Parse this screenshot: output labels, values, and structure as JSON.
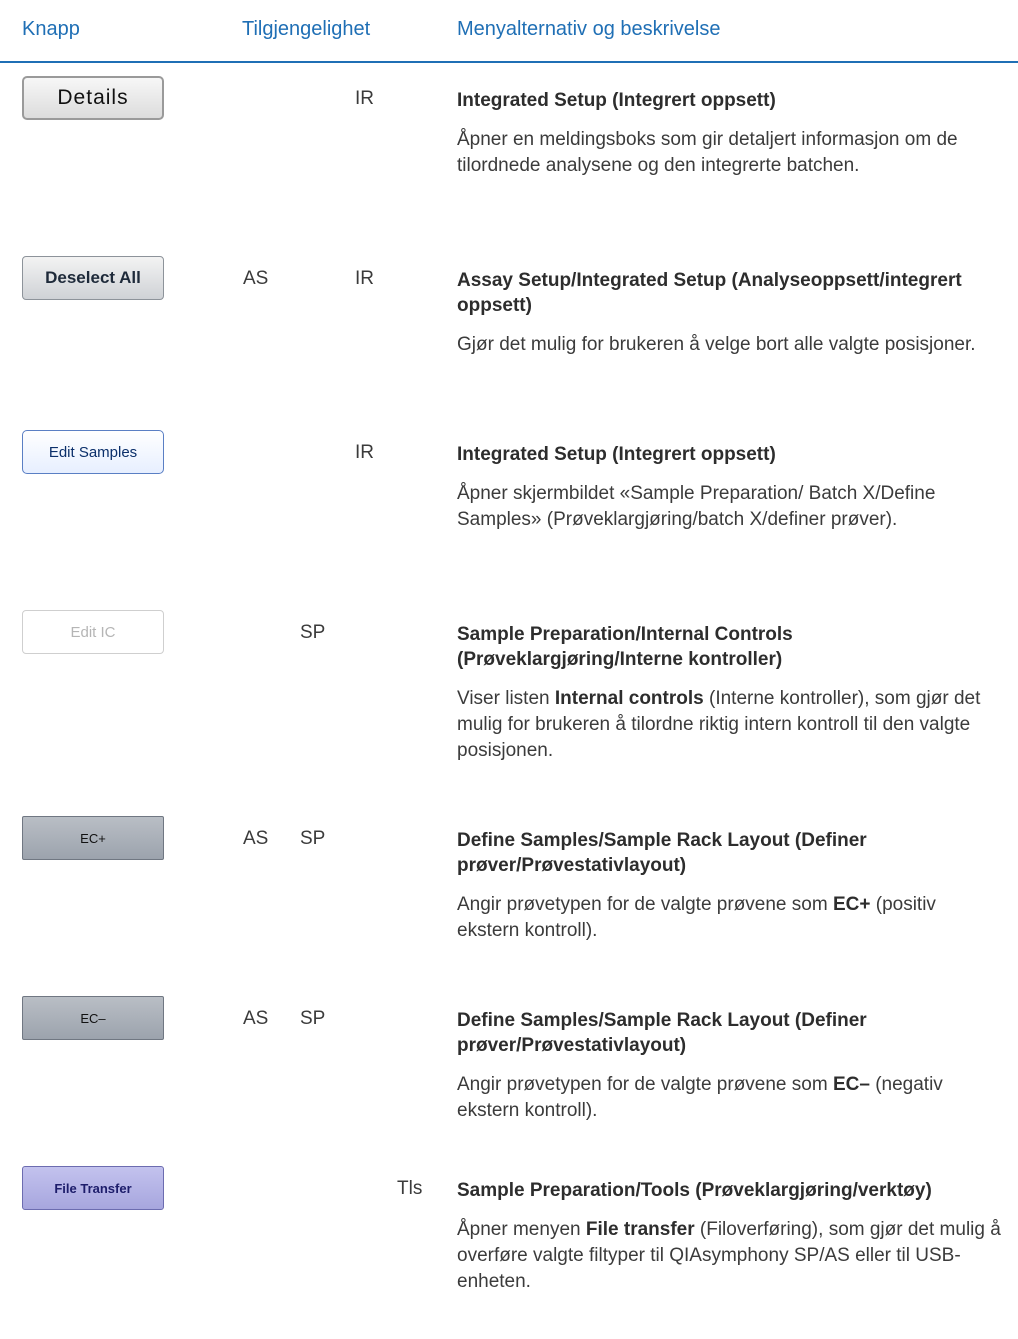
{
  "header": {
    "col1": "Knapp",
    "col2": "Tilgjengelighet",
    "col3": "Menyalternativ og beskrivelse"
  },
  "rows": [
    {
      "button_label": "Details",
      "avail_as": "",
      "avail_sp": "",
      "avail_ir": "IR",
      "avail_tls": "",
      "title": "Integrated Setup (Integrert oppsett)",
      "text": "Åpner en meldingsboks som gir detaljert informasjon om de tilordnede analysene og den integrerte batchen."
    },
    {
      "button_label": "Deselect All",
      "avail_as": "AS",
      "avail_sp": "",
      "avail_ir": "IR",
      "avail_tls": "",
      "title": "Assay Setup/Integrated Setup (Analyseoppsett/integrert oppsett)",
      "text": "Gjør det mulig for brukeren å velge bort alle valgte posisjoner."
    },
    {
      "button_label": "Edit Samples",
      "avail_as": "",
      "avail_sp": "",
      "avail_ir": "IR",
      "avail_tls": "",
      "title": "Integrated Setup (Integrert oppsett)",
      "text": "Åpner skjermbildet «Sample Preparation/ Batch X/Define Samples» (Prøveklargjøring/batch X/definer prøver)."
    },
    {
      "button_label": "Edit IC",
      "avail_as": "",
      "avail_sp": "SP",
      "avail_ir": "",
      "avail_tls": "",
      "title": "Sample Preparation/Internal Controls (Prøveklargjøring/Interne kontroller)",
      "text_pre": "Viser listen ",
      "text_bold": "Internal controls",
      "text_post": " (Interne kontroller), som gjør det mulig for brukeren å tilordne riktig intern kontroll til den valgte posisjonen."
    },
    {
      "button_label": "EC+",
      "avail_as": "AS",
      "avail_sp": "SP",
      "avail_ir": "",
      "avail_tls": "",
      "title": "Define Samples/Sample Rack Layout (Definer prøver/Prøvestativlayout)",
      "text_pre": "Angir prøvetypen for de valgte prøvene som ",
      "text_bold": "EC+",
      "text_post": " (positiv ekstern kontroll)."
    },
    {
      "button_label": "EC–",
      "avail_as": "AS",
      "avail_sp": "SP",
      "avail_ir": "",
      "avail_tls": "",
      "title": "Define Samples/Sample Rack Layout (Definer prøver/Prøvestativlayout)",
      "text_pre": "Angir prøvetypen for de valgte prøvene som ",
      "text_bold": "EC–",
      "text_post": " (negativ ekstern kontroll)."
    },
    {
      "button_label": "File Transfer",
      "avail_as": "",
      "avail_sp": "",
      "avail_ir": "",
      "avail_tls": "Tls",
      "title": "Sample Preparation/Tools (Prøveklargjøring/verktøy)",
      "text_pre": "Åpner menyen ",
      "text_bold": "File transfer",
      "text_post": " (Filoverføring), som gjør det mulig å overføre valgte filtyper til QIAsymphony SP/AS eller til USB-enheten."
    }
  ]
}
